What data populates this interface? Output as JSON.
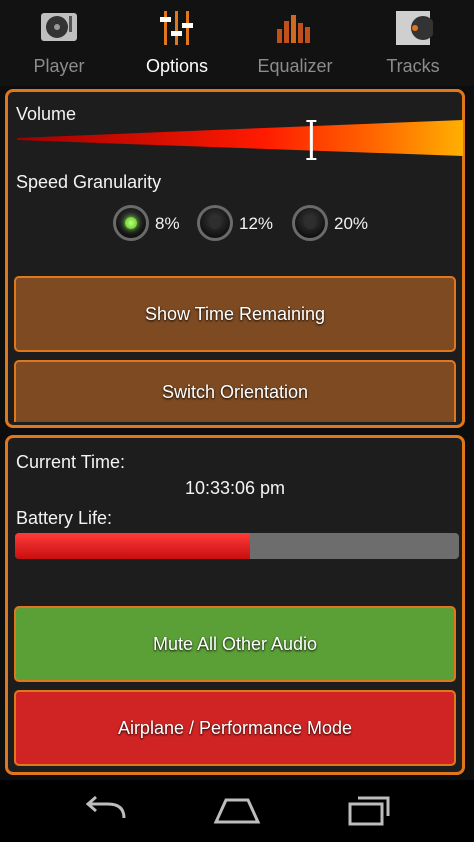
{
  "tabs": [
    {
      "label": "Player",
      "icon": "turntable-icon",
      "active": false
    },
    {
      "label": "Options",
      "icon": "sliders-icon",
      "active": true
    },
    {
      "label": "Equalizer",
      "icon": "equalizer-bars-icon",
      "active": false
    },
    {
      "label": "Tracks",
      "icon": "record-sleeve-icon",
      "active": false
    }
  ],
  "options": {
    "volume_label": "Volume",
    "volume_level": 0.66,
    "speed_label": "Speed Granularity",
    "speed_options": [
      "8%",
      "12%",
      "20%"
    ],
    "speed_selected": "8%",
    "show_time_remaining": "Show Time Remaining",
    "switch_orientation": "Switch Orientation"
  },
  "status": {
    "current_time_label": "Current Time:",
    "current_time": "10:33:06 pm",
    "battery_label": "Battery Life:",
    "battery_level": 0.53,
    "mute_all": "Mute All Other Audio",
    "airplane_mode": "Airplane / Performance Mode"
  },
  "nav": [
    "back-icon",
    "home-icon",
    "recent-apps-icon"
  ],
  "colors": {
    "accent": "#e0771d",
    "brown_button": "#7d4a22",
    "green_button": "#5b9f37",
    "red_button": "#d02424",
    "battery_fill": "#e01b1b"
  }
}
